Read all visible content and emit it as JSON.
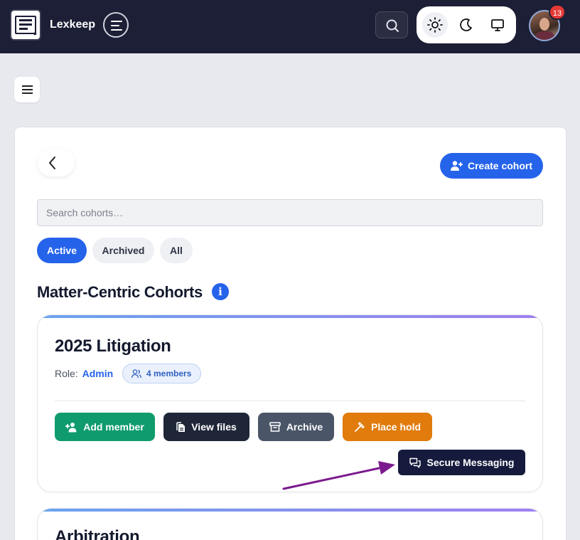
{
  "app": {
    "name": "Lexkeep",
    "notification_count": "13"
  },
  "search": {
    "placeholder": "Search cohorts…"
  },
  "toolbar": {
    "create_label": "Create cohort"
  },
  "filters": [
    {
      "label": "Active",
      "selected": true
    },
    {
      "label": "Archived",
      "selected": false
    },
    {
      "label": "All",
      "selected": false
    }
  ],
  "section": {
    "title": "Matter-Centric Cohorts",
    "info_icon": "i"
  },
  "cohorts": [
    {
      "name": "2025 Litigation",
      "role_label": "Role:",
      "role_value": "Admin",
      "members": "4 members",
      "actions": {
        "add_member": "Add member",
        "view_files": "View files",
        "archive": "Archive",
        "place_hold": "Place hold",
        "secure_messaging": "Secure Messaging"
      }
    },
    {
      "name": "Arbitration"
    }
  ],
  "colors": {
    "nav_bg": "#1c1f35",
    "primary": "#2563eb",
    "add_member": "#0f9b6e",
    "view_files": "#1e2638",
    "archive": "#4a5568",
    "place_hold": "#e07b0c",
    "secure_messaging": "#161b3d",
    "annotation_arrow": "#7b1a8e"
  },
  "icons": [
    "logo-icon",
    "menu-toggle-icon",
    "search-icon",
    "sun-icon",
    "moon-icon",
    "monitor-icon",
    "hamburger-icon",
    "chevron-left-icon",
    "user-plus-icon",
    "info-icon",
    "users-icon",
    "file-icon",
    "archive-icon",
    "hammer-icon",
    "chat-icon"
  ]
}
